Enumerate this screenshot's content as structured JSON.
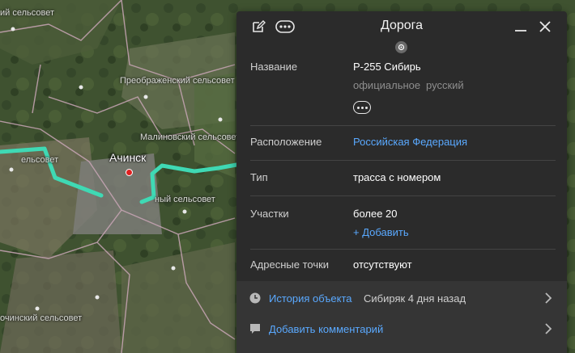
{
  "map": {
    "city": "Ачинск",
    "labels": [
      "ий сельсовет",
      "Преображенский сельсовет",
      "Малиновский сельсовет",
      "ельсовет",
      "ный сельсовет",
      "очинский сельсовет"
    ]
  },
  "panel": {
    "title": "Дорога",
    "rows": {
      "name_label": "Название",
      "name_value": "Р-255 Сибирь",
      "name_lang1": "официальное",
      "name_lang2": "русский",
      "location_label": "Расположение",
      "location_value": "Российская Федерация",
      "type_label": "Тип",
      "type_value": "трасса с номером",
      "sections_label": "Участки",
      "sections_value": "более 20",
      "sections_add": "+ Добавить",
      "address_label": "Адресные точки",
      "address_value": "отсутствуют"
    },
    "footer": {
      "history_label": "История объекта",
      "history_meta": "Сибиряк 4 дня назад",
      "comment_label": "Добавить комментарий"
    }
  },
  "colors": {
    "road": "#3fd9b4",
    "link": "#5aa9ff",
    "panel_bg": "#2b2b2b",
    "city_dot": "#e02020"
  }
}
